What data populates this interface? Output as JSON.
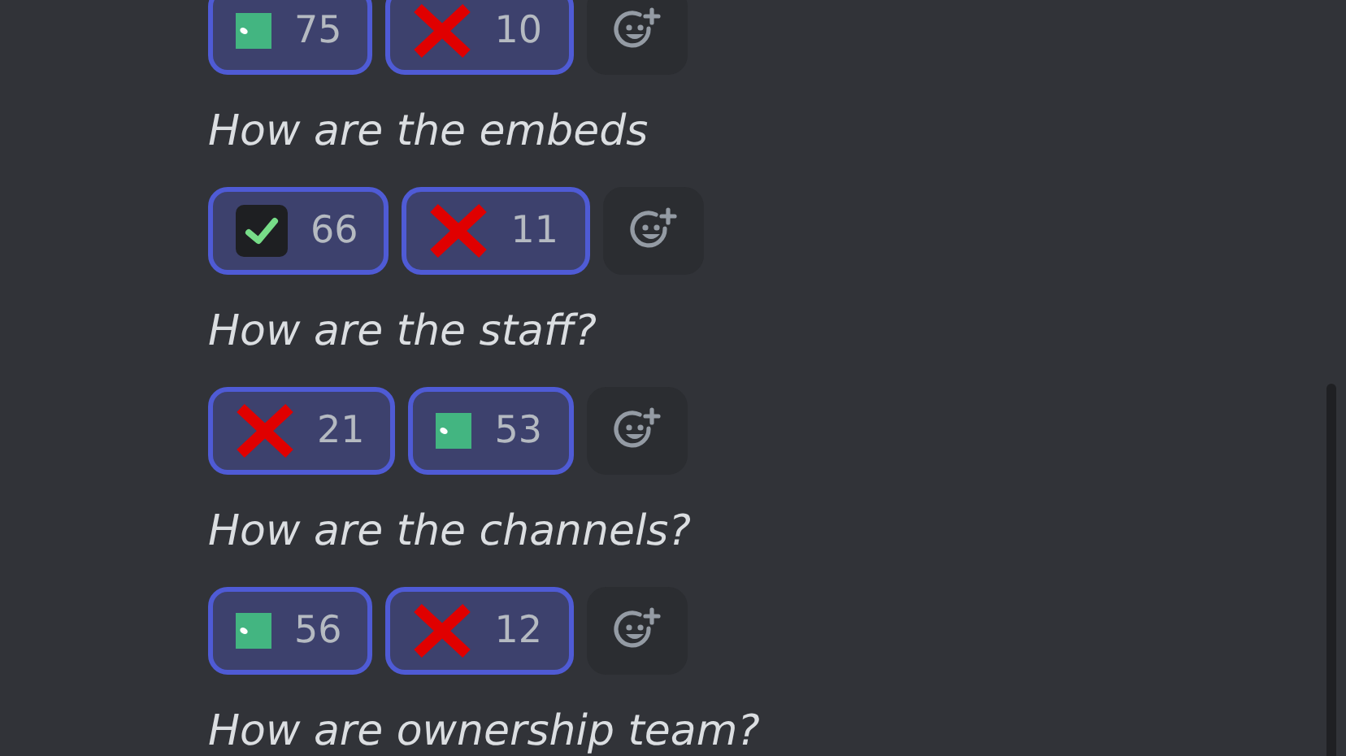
{
  "rows": [
    {
      "kind": "reactions",
      "reactions": [
        {
          "kind": "square",
          "count": "75",
          "selected": true
        },
        {
          "kind": "cross",
          "count": "10",
          "selected": true
        }
      ]
    },
    {
      "kind": "text",
      "text": "How are the embeds"
    },
    {
      "kind": "reactions",
      "reactions": [
        {
          "kind": "check",
          "count": "66",
          "selected": true
        },
        {
          "kind": "cross",
          "count": "11",
          "selected": true
        }
      ]
    },
    {
      "kind": "text",
      "text": "How are the staff?"
    },
    {
      "kind": "reactions",
      "reactions": [
        {
          "kind": "cross",
          "count": "21",
          "selected": true
        },
        {
          "kind": "square",
          "count": "53",
          "selected": true
        }
      ]
    },
    {
      "kind": "text",
      "text": "How are the channels?"
    },
    {
      "kind": "reactions",
      "reactions": [
        {
          "kind": "square",
          "count": "56",
          "selected": true
        },
        {
          "kind": "cross",
          "count": "12",
          "selected": true
        }
      ]
    },
    {
      "kind": "text",
      "text": "How are ownership team?"
    }
  ]
}
